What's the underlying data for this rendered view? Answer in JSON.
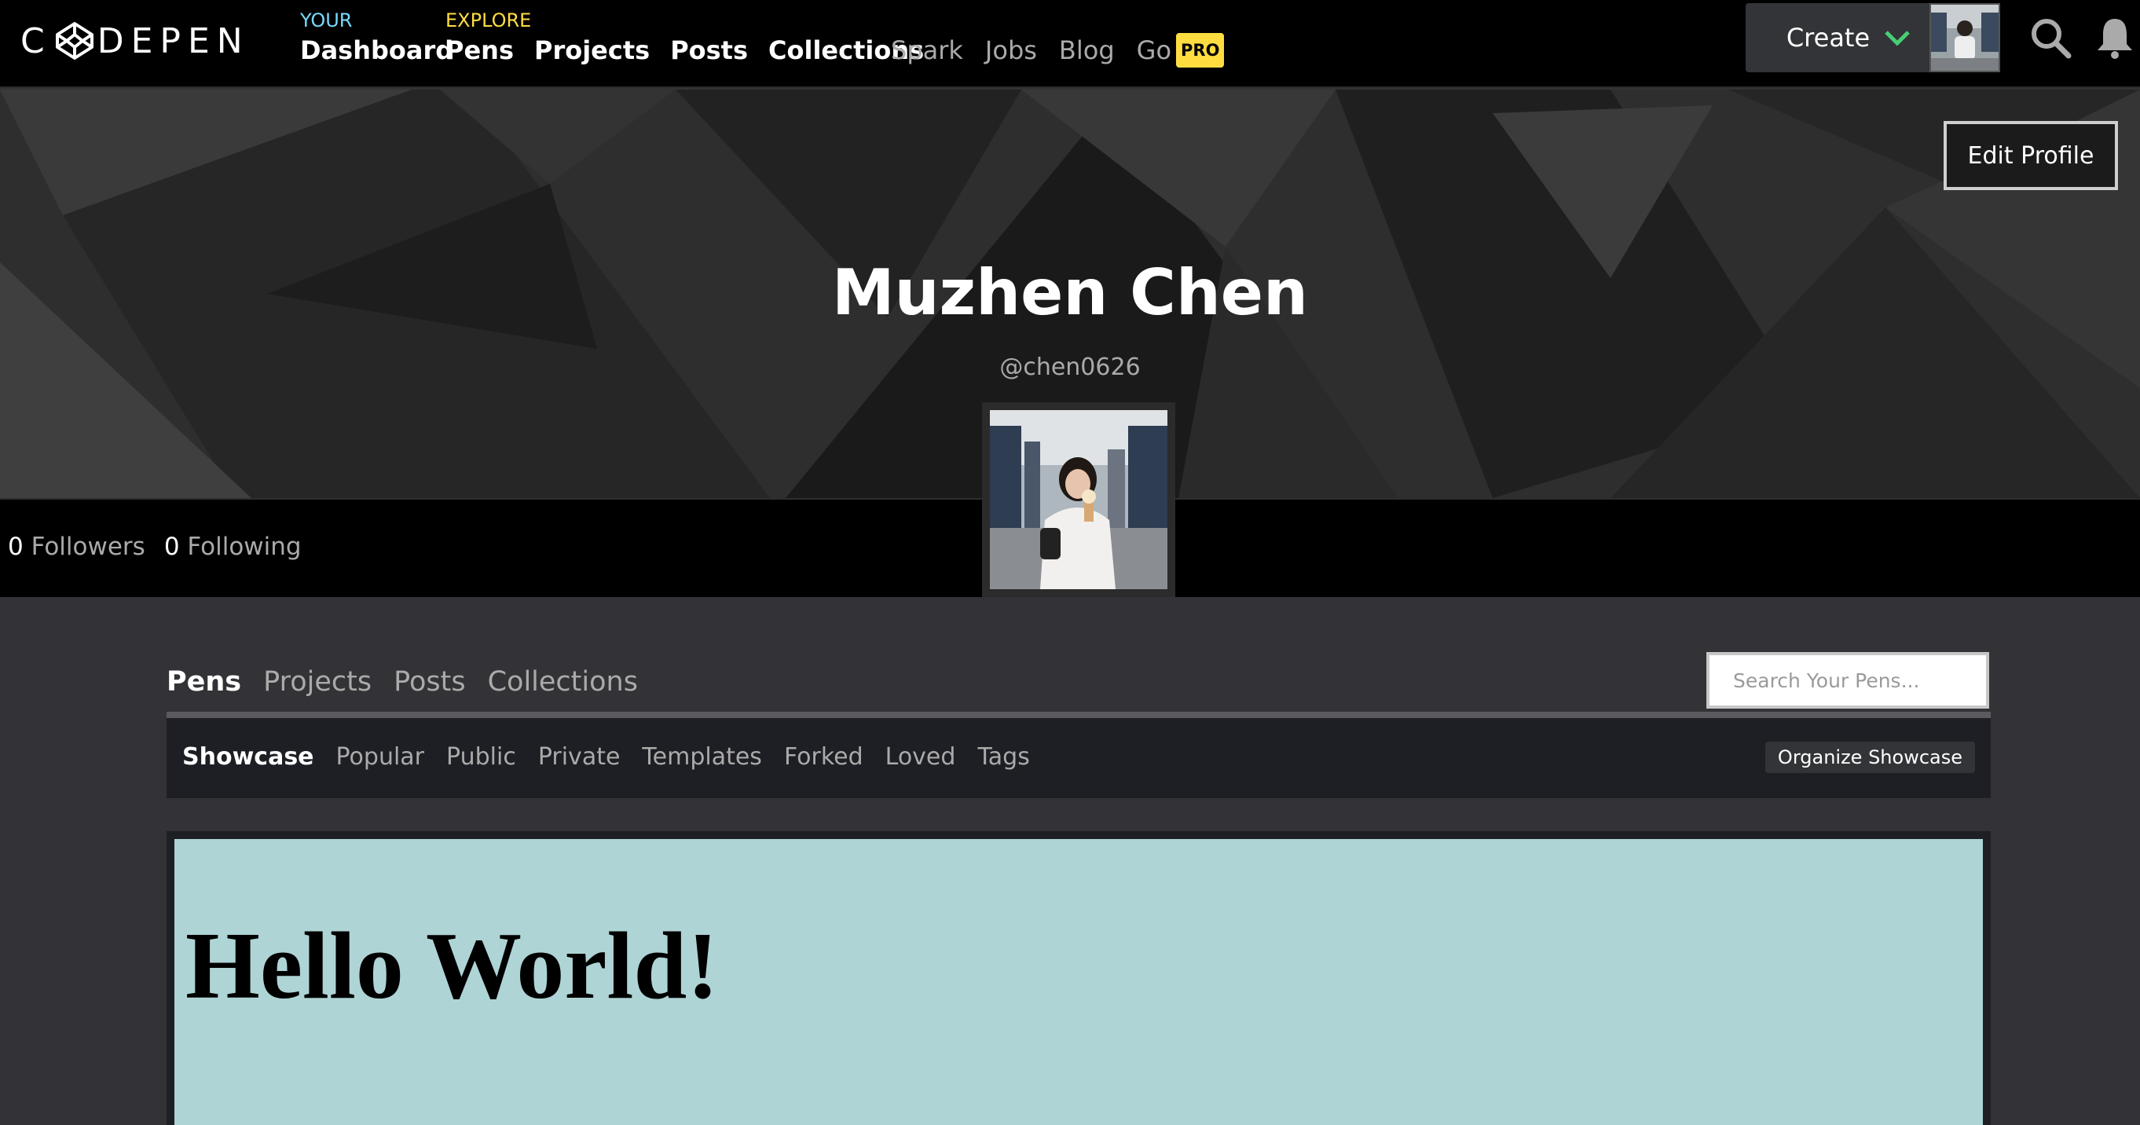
{
  "brand": {
    "logo_prefix": "C",
    "logo_suffix": "DEPEN"
  },
  "nav": {
    "your_label": "YOUR",
    "explore_label": "EXPLORE",
    "your_links": [
      "Dashboard"
    ],
    "explore_links": [
      "Pens",
      "Projects",
      "Posts",
      "Collections"
    ],
    "secondary_links": [
      "Spark",
      "Jobs",
      "Blog",
      "Go"
    ],
    "pro_badge": "PRO",
    "create_label": "Create"
  },
  "profile": {
    "name": "Muzhen Chen",
    "handle": "@chen0626",
    "edit_label": "Edit Profile",
    "followers_count": "0",
    "followers_label": "Followers",
    "following_count": "0",
    "following_label": "Following"
  },
  "tabs": {
    "main": [
      "Pens",
      "Projects",
      "Posts",
      "Collections"
    ],
    "sub": [
      "Showcase",
      "Popular",
      "Public",
      "Private",
      "Templates",
      "Forked",
      "Loved",
      "Tags"
    ]
  },
  "search": {
    "placeholder": "Search Your Pens..."
  },
  "organize_label": "Organize Showcase",
  "pen": {
    "preview_heading": "Hello World!"
  },
  "colors": {
    "your_accent": "#76daff",
    "explore_accent": "#ffdd40",
    "create_chevron": "#47cf73",
    "pen_preview_bg": "#afd4d5"
  }
}
